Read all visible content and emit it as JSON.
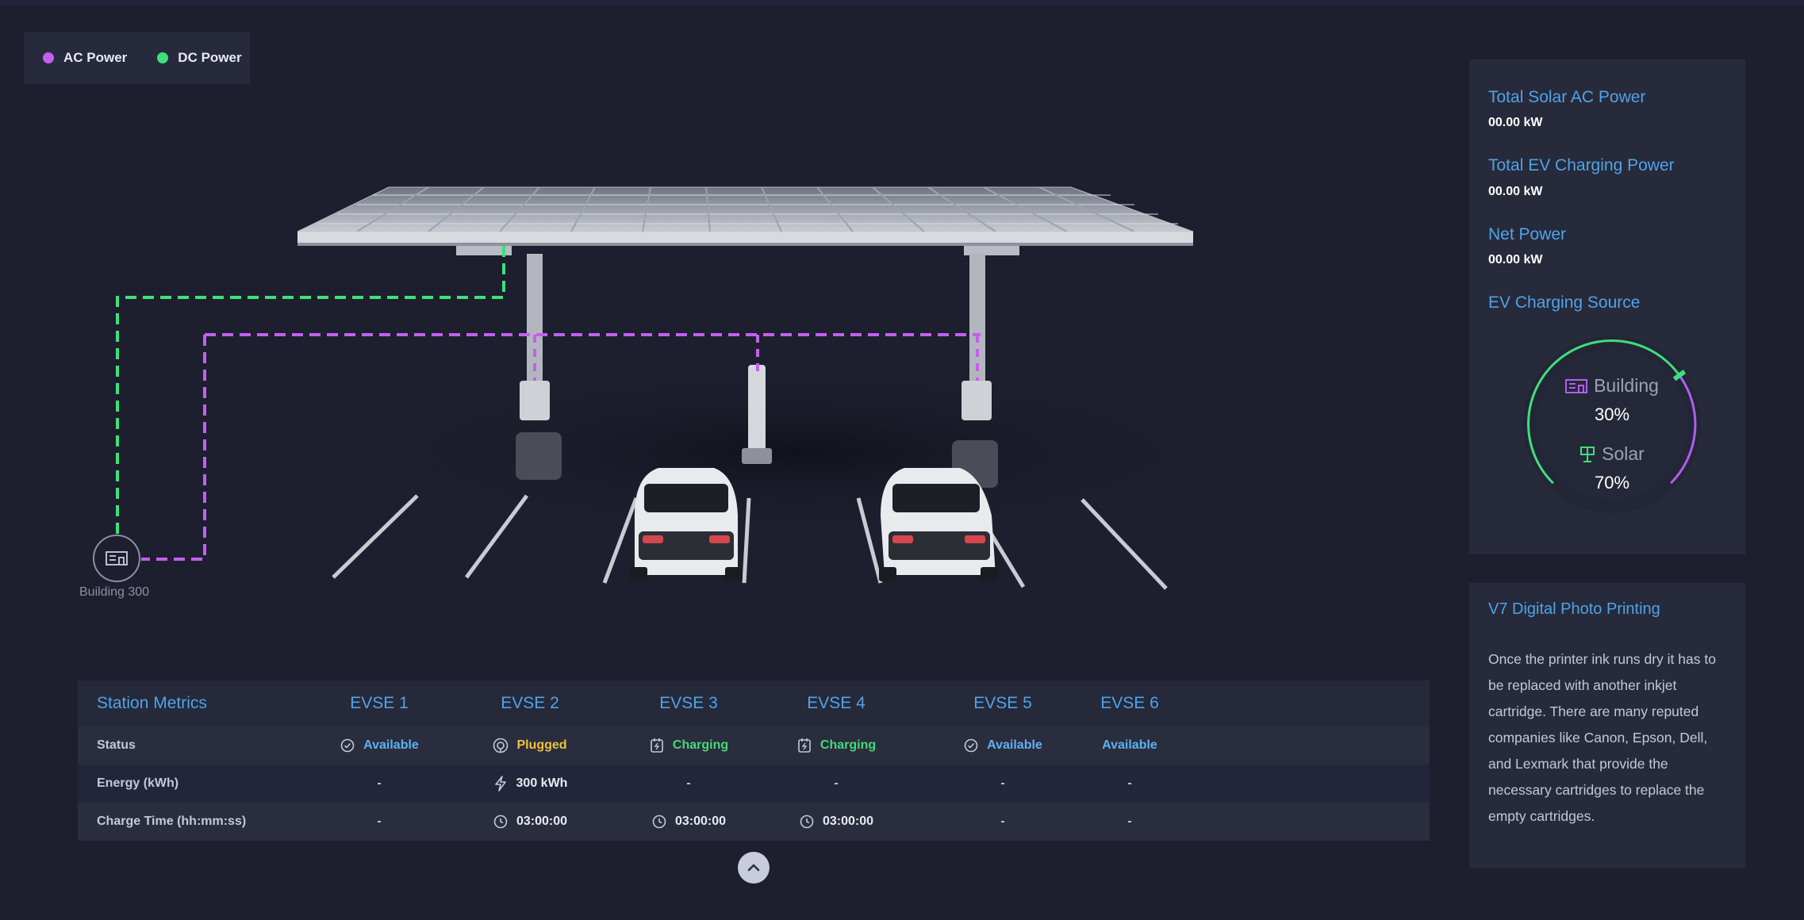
{
  "legend": {
    "ac_label": "AC Power",
    "dc_label": "DC Power",
    "ac_color": "#c45ff0",
    "dc_color": "#3ee07a"
  },
  "scene": {
    "building_label": "Building 300"
  },
  "power_panel": {
    "metrics": [
      {
        "title": "Total Solar AC Power",
        "value": "00.00 kW"
      },
      {
        "title": "Total EV Charging Power",
        "value": "00.00 kW"
      },
      {
        "title": "Net Power",
        "value": "00.00 kW"
      }
    ],
    "source_title": "EV Charging Source",
    "gauge": {
      "building_label": "Building",
      "building_value": "30%",
      "solar_label": "Solar",
      "solar_value": "70%",
      "building_fraction": 0.3,
      "solar_fraction": 0.7
    }
  },
  "info_panel": {
    "title": "V7 Digital Photo Printing",
    "body": "Once the printer ink runs dry it has to be replaced with another inkjet cartridge. There are many reputed companies like Canon, Epson, Dell, and Lexmark that provide the necessary cartridges to replace the empty cartridges."
  },
  "table": {
    "title": "Station Metrics",
    "columns": [
      "EVSE 1",
      "EVSE 2",
      "EVSE 3",
      "EVSE 4",
      "EVSE 5",
      "EVSE 6"
    ],
    "row_labels": {
      "status": "Status",
      "energy": "Energy (kWh)",
      "charge_time": "Charge Time (hh:mm:ss)"
    },
    "status": [
      "Available",
      "Plugged",
      "Charging",
      "Charging",
      "Available",
      "Available"
    ],
    "energy": [
      "-",
      "300 kWh",
      "-",
      "-",
      "-",
      "-"
    ],
    "charge_time": [
      "-",
      "03:00:00",
      "03:00:00",
      "03:00:00",
      "-",
      "-"
    ]
  }
}
